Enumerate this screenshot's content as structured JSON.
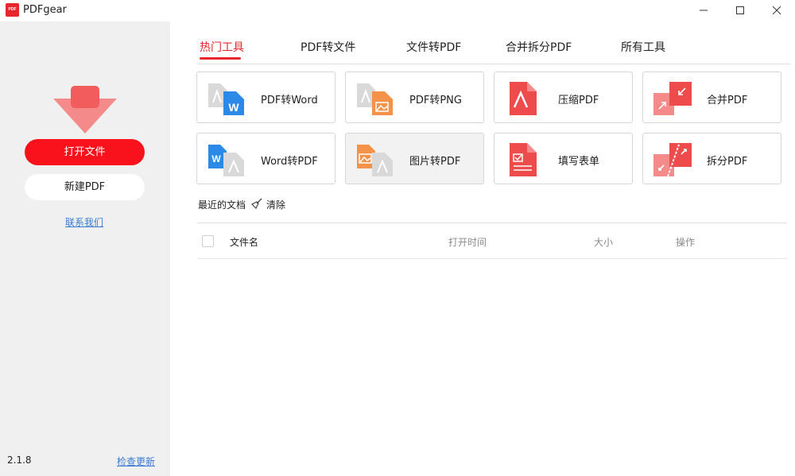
{
  "window": {
    "title": "PDFgear",
    "logo_text": "PDF"
  },
  "sidebar": {
    "open_file": "打开文件",
    "new_pdf": "新建PDF",
    "contact": "联系我们",
    "version": "2.1.8",
    "check_update": "检查更新"
  },
  "tabs": [
    "热门工具",
    "PDF转文件",
    "文件转PDF",
    "合并拆分PDF",
    "所有工具"
  ],
  "tools": [
    {
      "label": "PDF转Word",
      "icon": "pdf-to-word-icon"
    },
    {
      "label": "PDF转PNG",
      "icon": "pdf-to-png-icon"
    },
    {
      "label": "压缩PDF",
      "icon": "compress-pdf-icon"
    },
    {
      "label": "合并PDF",
      "icon": "merge-pdf-icon"
    },
    {
      "label": "Word转PDF",
      "icon": "word-to-pdf-icon"
    },
    {
      "label": "图片转PDF",
      "icon": "image-to-pdf-icon"
    },
    {
      "label": "填写表单",
      "icon": "fill-form-icon"
    },
    {
      "label": "拆分PDF",
      "icon": "split-pdf-icon"
    }
  ],
  "recent": {
    "title": "最近的文档",
    "clear": "清除",
    "columns": {
      "name": "文件名",
      "open_time": "打开时间",
      "size": "大小",
      "action": "操作"
    }
  },
  "colors": {
    "accent": "#e8262d",
    "button_red": "#f9111c",
    "link": "#3b7bd4",
    "word_blue": "#2b8ae8",
    "image_orange": "#f5924a"
  }
}
